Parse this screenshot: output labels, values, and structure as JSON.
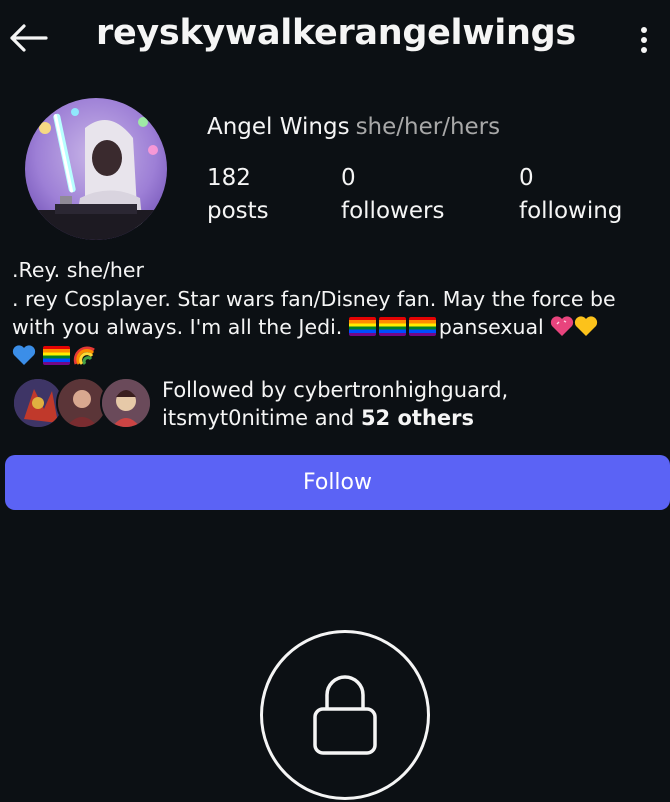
{
  "header": {
    "username": "reyskywalkerangelwings",
    "back_icon": "arrow-left-icon",
    "more_icon": "more-vertical-icon"
  },
  "profile": {
    "display_name": "Angel Wings",
    "pronouns": "she/her/hers",
    "stats": [
      {
        "count": "182",
        "label": "posts"
      },
      {
        "count": "0",
        "label": "followers"
      },
      {
        "count": "0",
        "label": "following"
      }
    ],
    "bio": {
      "line1": ".Rey.  she/her",
      "line2": ". rey Cosplayer. Star wars fan/Disney fan. May the force be",
      "line3_text": "with you always.  I'm all the Jedi. ",
      "line3_after_flags": "pansexual "
    }
  },
  "followed_by": {
    "prefix": "Followed by cybertronhighguard,",
    "line2_prefix": "itsmyt0nitime and ",
    "others": "52 others"
  },
  "actions": {
    "follow_label": "Follow"
  },
  "colors": {
    "background": "#0c1014",
    "follow_button": "#5b63f5",
    "secondary_text": "#a8a8a8"
  }
}
